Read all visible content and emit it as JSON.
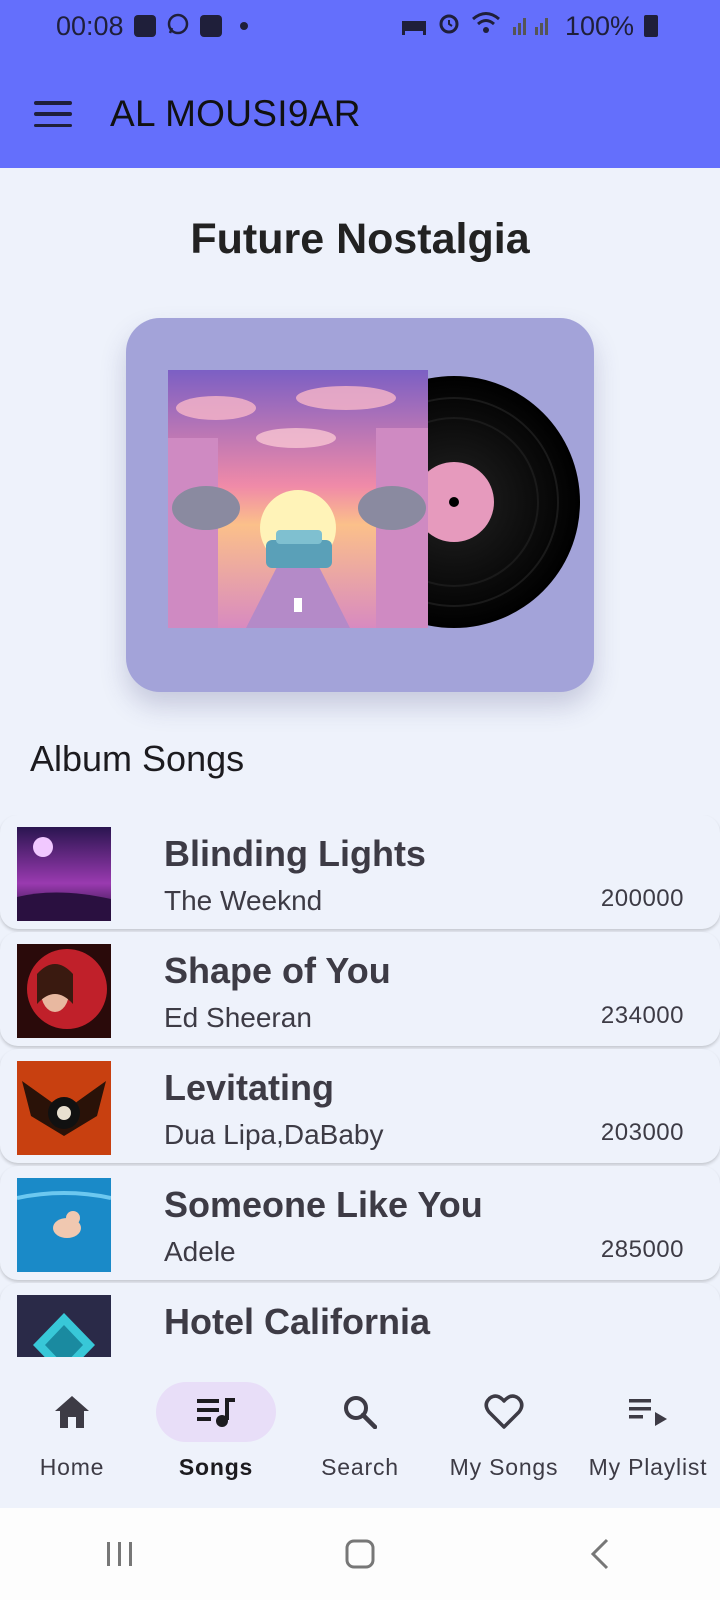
{
  "status_bar": {
    "time": "00:08",
    "battery": "100%"
  },
  "app_bar": {
    "title": "AL MOUSI9AR"
  },
  "album": {
    "title": "Future Nostalgia"
  },
  "section": {
    "title": "Album Songs"
  },
  "songs": [
    {
      "title": "Blinding Lights",
      "artist": "The Weeknd",
      "plays": "200000"
    },
    {
      "title": "Shape of You",
      "artist": "Ed Sheeran",
      "plays": "234000"
    },
    {
      "title": "Levitating",
      "artist": "Dua Lipa,DaBaby",
      "plays": "203000"
    },
    {
      "title": "Someone Like You",
      "artist": "Adele",
      "plays": "285000"
    },
    {
      "title": "Hotel California",
      "artist": "",
      "plays": ""
    }
  ],
  "bottom_nav": {
    "items": [
      {
        "label": "Home",
        "icon": "home-icon"
      },
      {
        "label": "Songs",
        "icon": "queue-music-icon"
      },
      {
        "label": "Search",
        "icon": "search-icon"
      },
      {
        "label": "My Songs",
        "icon": "heart-icon"
      },
      {
        "label": "My Playlist",
        "icon": "playlist-play-icon"
      }
    ],
    "active": "Songs"
  },
  "colors": {
    "app_bar": "#646ffc",
    "background": "#eef2fb",
    "album_card": "#a3a3d9",
    "nav_active_pill": "#e8def8"
  }
}
